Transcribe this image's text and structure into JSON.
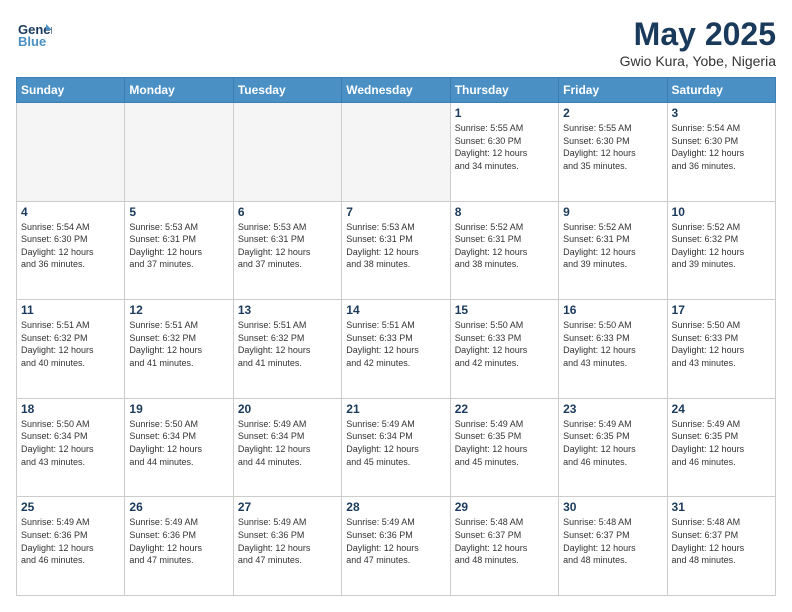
{
  "header": {
    "logo_line1": "General",
    "logo_line2": "Blue",
    "month_title": "May 2025",
    "location": "Gwio Kura, Yobe, Nigeria"
  },
  "weekdays": [
    "Sunday",
    "Monday",
    "Tuesday",
    "Wednesday",
    "Thursday",
    "Friday",
    "Saturday"
  ],
  "weeks": [
    [
      {
        "day": "",
        "info": ""
      },
      {
        "day": "",
        "info": ""
      },
      {
        "day": "",
        "info": ""
      },
      {
        "day": "",
        "info": ""
      },
      {
        "day": "1",
        "info": "Sunrise: 5:55 AM\nSunset: 6:30 PM\nDaylight: 12 hours\nand 34 minutes."
      },
      {
        "day": "2",
        "info": "Sunrise: 5:55 AM\nSunset: 6:30 PM\nDaylight: 12 hours\nand 35 minutes."
      },
      {
        "day": "3",
        "info": "Sunrise: 5:54 AM\nSunset: 6:30 PM\nDaylight: 12 hours\nand 36 minutes."
      }
    ],
    [
      {
        "day": "4",
        "info": "Sunrise: 5:54 AM\nSunset: 6:30 PM\nDaylight: 12 hours\nand 36 minutes."
      },
      {
        "day": "5",
        "info": "Sunrise: 5:53 AM\nSunset: 6:31 PM\nDaylight: 12 hours\nand 37 minutes."
      },
      {
        "day": "6",
        "info": "Sunrise: 5:53 AM\nSunset: 6:31 PM\nDaylight: 12 hours\nand 37 minutes."
      },
      {
        "day": "7",
        "info": "Sunrise: 5:53 AM\nSunset: 6:31 PM\nDaylight: 12 hours\nand 38 minutes."
      },
      {
        "day": "8",
        "info": "Sunrise: 5:52 AM\nSunset: 6:31 PM\nDaylight: 12 hours\nand 38 minutes."
      },
      {
        "day": "9",
        "info": "Sunrise: 5:52 AM\nSunset: 6:31 PM\nDaylight: 12 hours\nand 39 minutes."
      },
      {
        "day": "10",
        "info": "Sunrise: 5:52 AM\nSunset: 6:32 PM\nDaylight: 12 hours\nand 39 minutes."
      }
    ],
    [
      {
        "day": "11",
        "info": "Sunrise: 5:51 AM\nSunset: 6:32 PM\nDaylight: 12 hours\nand 40 minutes."
      },
      {
        "day": "12",
        "info": "Sunrise: 5:51 AM\nSunset: 6:32 PM\nDaylight: 12 hours\nand 41 minutes."
      },
      {
        "day": "13",
        "info": "Sunrise: 5:51 AM\nSunset: 6:32 PM\nDaylight: 12 hours\nand 41 minutes."
      },
      {
        "day": "14",
        "info": "Sunrise: 5:51 AM\nSunset: 6:33 PM\nDaylight: 12 hours\nand 42 minutes."
      },
      {
        "day": "15",
        "info": "Sunrise: 5:50 AM\nSunset: 6:33 PM\nDaylight: 12 hours\nand 42 minutes."
      },
      {
        "day": "16",
        "info": "Sunrise: 5:50 AM\nSunset: 6:33 PM\nDaylight: 12 hours\nand 43 minutes."
      },
      {
        "day": "17",
        "info": "Sunrise: 5:50 AM\nSunset: 6:33 PM\nDaylight: 12 hours\nand 43 minutes."
      }
    ],
    [
      {
        "day": "18",
        "info": "Sunrise: 5:50 AM\nSunset: 6:34 PM\nDaylight: 12 hours\nand 43 minutes."
      },
      {
        "day": "19",
        "info": "Sunrise: 5:50 AM\nSunset: 6:34 PM\nDaylight: 12 hours\nand 44 minutes."
      },
      {
        "day": "20",
        "info": "Sunrise: 5:49 AM\nSunset: 6:34 PM\nDaylight: 12 hours\nand 44 minutes."
      },
      {
        "day": "21",
        "info": "Sunrise: 5:49 AM\nSunset: 6:34 PM\nDaylight: 12 hours\nand 45 minutes."
      },
      {
        "day": "22",
        "info": "Sunrise: 5:49 AM\nSunset: 6:35 PM\nDaylight: 12 hours\nand 45 minutes."
      },
      {
        "day": "23",
        "info": "Sunrise: 5:49 AM\nSunset: 6:35 PM\nDaylight: 12 hours\nand 46 minutes."
      },
      {
        "day": "24",
        "info": "Sunrise: 5:49 AM\nSunset: 6:35 PM\nDaylight: 12 hours\nand 46 minutes."
      }
    ],
    [
      {
        "day": "25",
        "info": "Sunrise: 5:49 AM\nSunset: 6:36 PM\nDaylight: 12 hours\nand 46 minutes."
      },
      {
        "day": "26",
        "info": "Sunrise: 5:49 AM\nSunset: 6:36 PM\nDaylight: 12 hours\nand 47 minutes."
      },
      {
        "day": "27",
        "info": "Sunrise: 5:49 AM\nSunset: 6:36 PM\nDaylight: 12 hours\nand 47 minutes."
      },
      {
        "day": "28",
        "info": "Sunrise: 5:49 AM\nSunset: 6:36 PM\nDaylight: 12 hours\nand 47 minutes."
      },
      {
        "day": "29",
        "info": "Sunrise: 5:48 AM\nSunset: 6:37 PM\nDaylight: 12 hours\nand 48 minutes."
      },
      {
        "day": "30",
        "info": "Sunrise: 5:48 AM\nSunset: 6:37 PM\nDaylight: 12 hours\nand 48 minutes."
      },
      {
        "day": "31",
        "info": "Sunrise: 5:48 AM\nSunset: 6:37 PM\nDaylight: 12 hours\nand 48 minutes."
      }
    ]
  ]
}
